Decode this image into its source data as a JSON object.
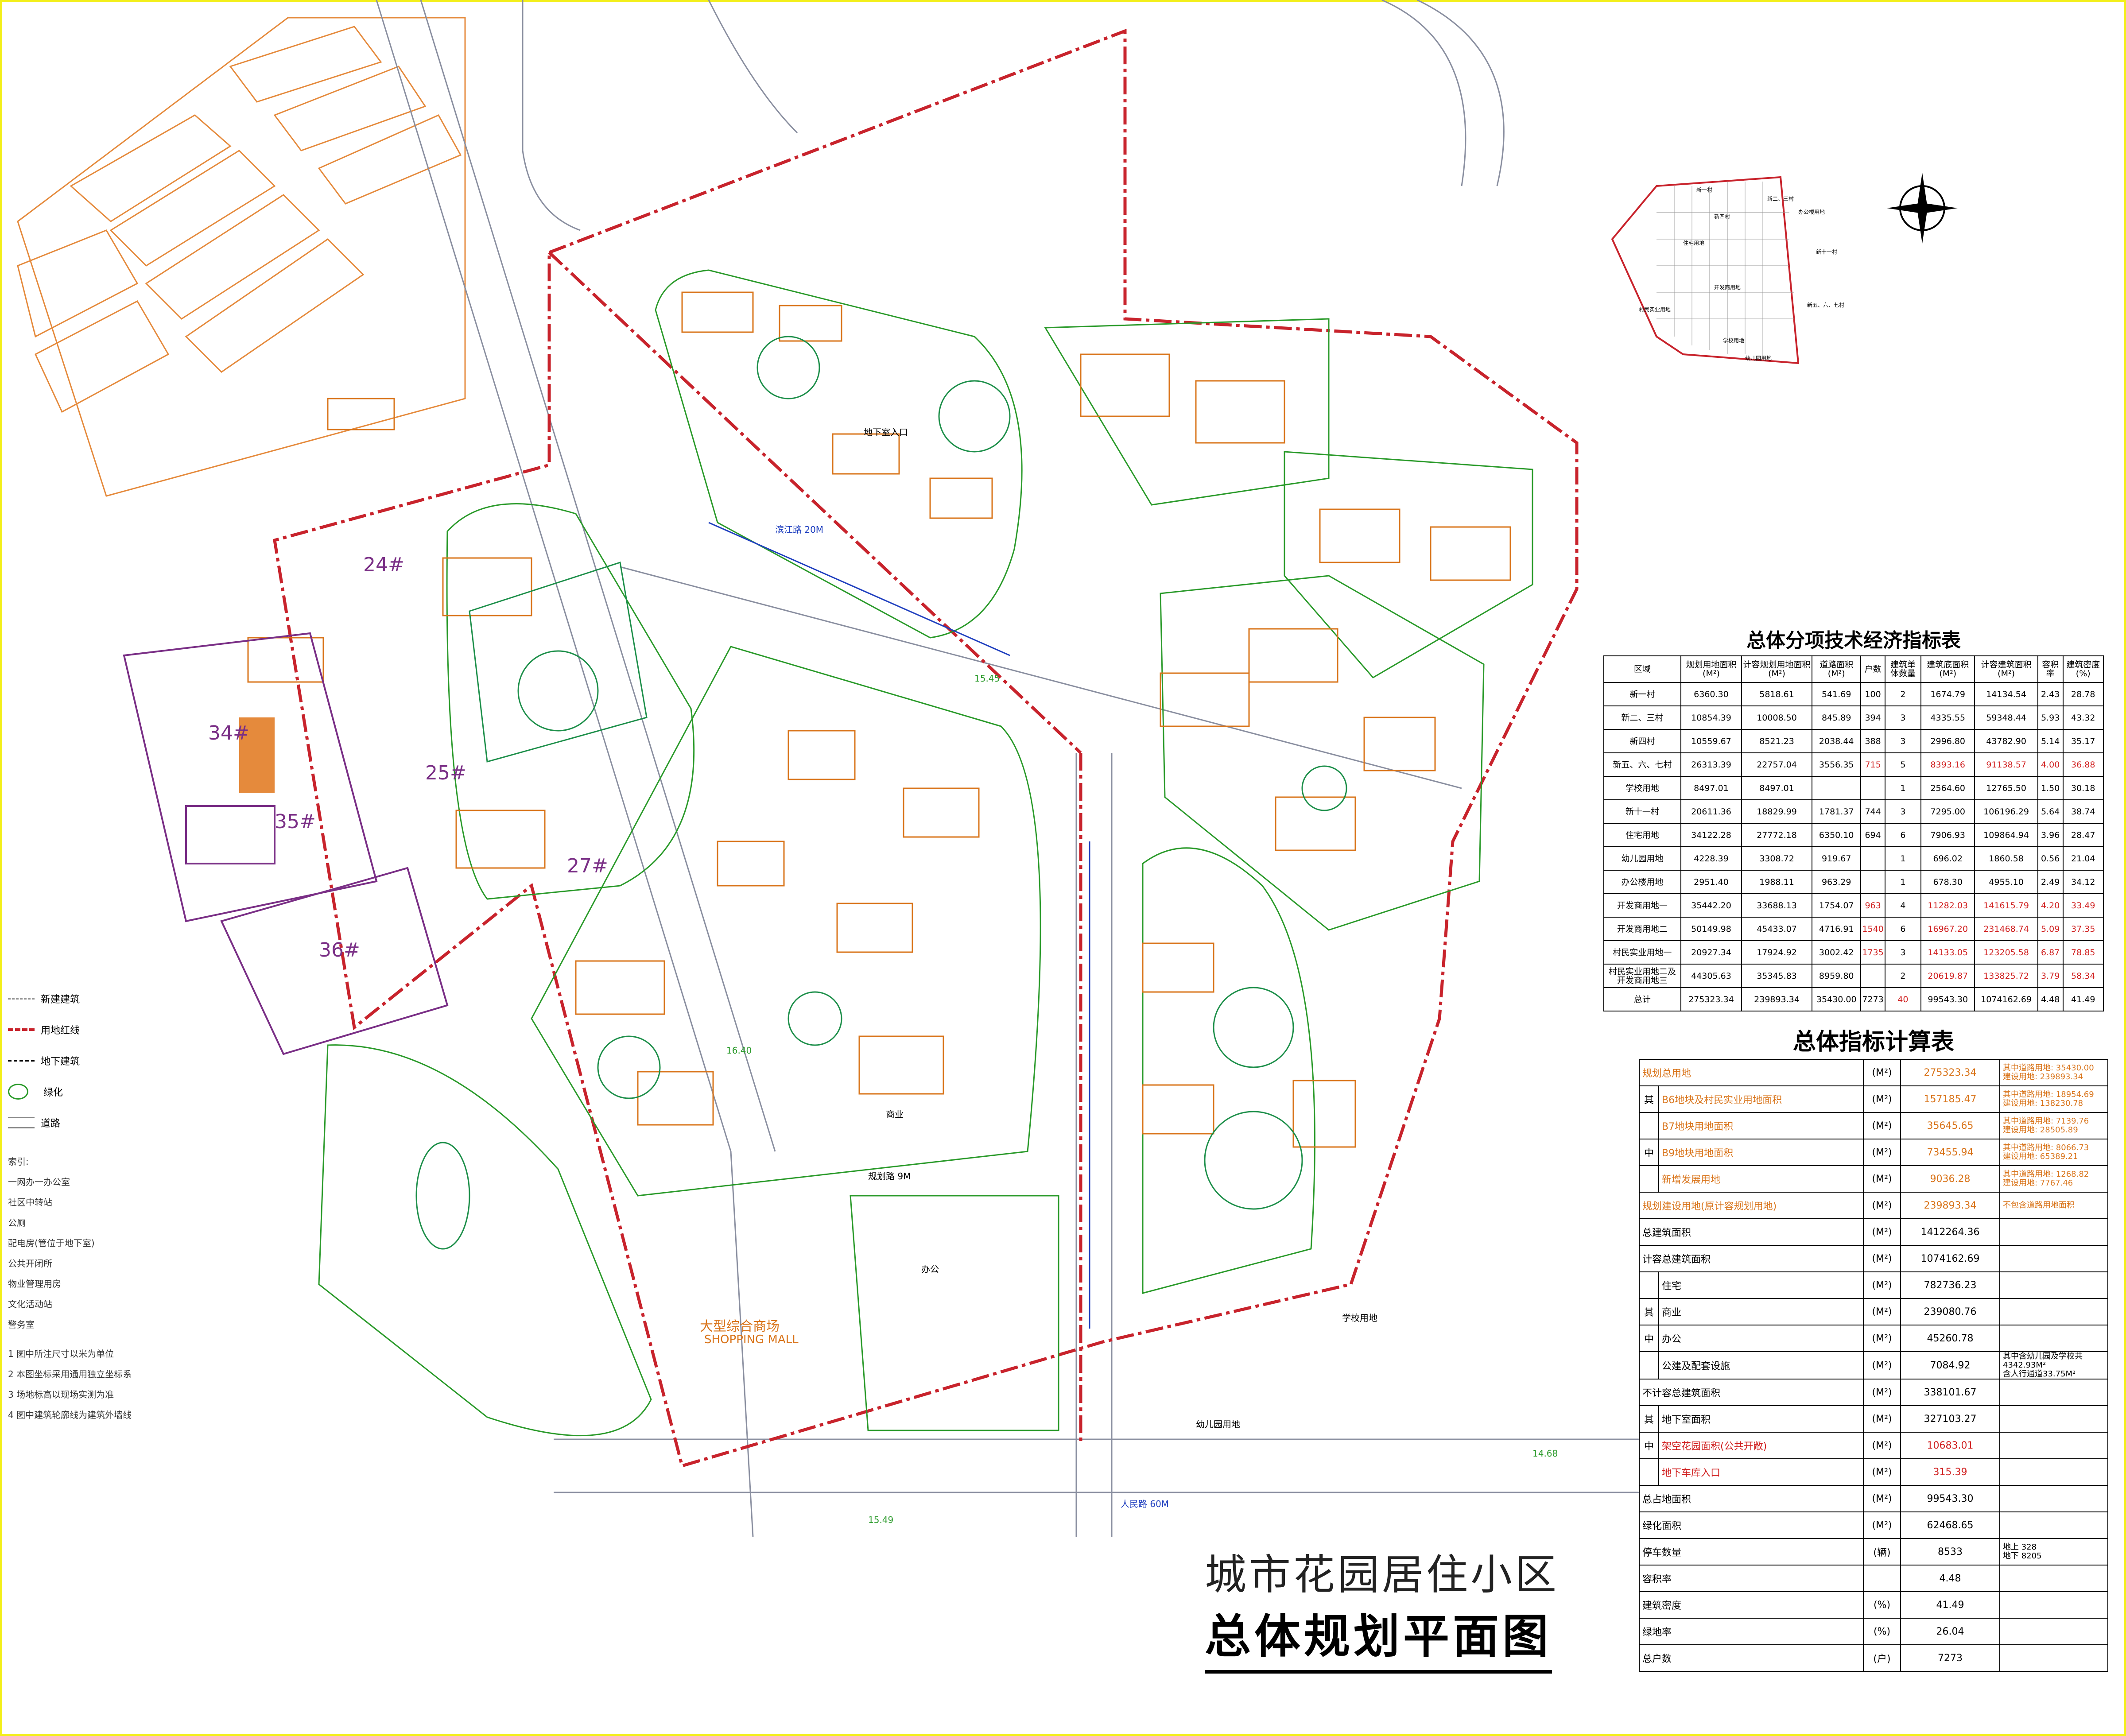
{
  "title": {
    "line1": "城市花园居住小区",
    "line2": "总体规划平面图"
  },
  "legend": [
    {
      "icon": "dashed-line-icon",
      "label": "新建建筑"
    },
    {
      "icon": "red-line-icon",
      "label": "用地红线"
    },
    {
      "icon": "dash-line-icon",
      "label": "地下建筑"
    },
    {
      "icon": "tree-icon",
      "label": "绿化"
    },
    {
      "icon": "road-icon",
      "label": "道路"
    }
  ],
  "index_title": "索引:",
  "index_items": [
    "一网办一办公室",
    "社区中转站",
    "公厕",
    "配电房(管位于地下室)",
    "公共开闭所",
    "物业管理用房",
    "文化活动站",
    "警务室"
  ],
  "notes": [
    "1 图中所注尺寸以米为单位",
    "2 本图坐标采用通用独立坐标系",
    "3 场地标高以现场实测为准",
    "4 图中建筑轮廓线为建筑外墙线"
  ],
  "labels": {
    "b24": "24#",
    "b25": "25#",
    "b27": "27#",
    "b34": "34#",
    "b35": "35#",
    "b36": "36#",
    "mall": "大型综合商场",
    "mall_en": "SHOPPING MALL",
    "road_renmin": "人民路 60M",
    "road_guihua": "规划路 9M",
    "road_binjiang": "滨江路 20M",
    "entry": "地下室入口",
    "school": "学校用地",
    "kindergarten": "幼儿园用地",
    "office": "办公",
    "shop": "商业",
    "elev1": "15.45",
    "elev2": "16.40",
    "elev3": "14.68",
    "elev4": "15.49"
  },
  "inset_map": {
    "labels": [
      "新一村",
      "新二、三村",
      "新四村",
      "新十一村",
      "新五、六、七村",
      "办公楼用地",
      "开发商用地",
      "住宅用地",
      "学校用地",
      "幼儿园用地",
      "村民实业用地"
    ]
  },
  "tech_table": {
    "title": "总体分项技术经济指标表",
    "headers": [
      "区域",
      "规划用地面积(M²)",
      "计容规划用地面积(M²)",
      "道路面积(M²)",
      "户数",
      "建筑单体数量",
      "建筑底面积(M²)",
      "计容建筑面积(M²)",
      "容积率",
      "建筑密度(%)"
    ],
    "rows": [
      [
        "新一村",
        "6360.30",
        "5818.61",
        "541.69",
        "100",
        "2",
        "1674.79",
        "14134.54",
        "2.43",
        "28.78"
      ],
      [
        "新二、三村",
        "10854.39",
        "10008.50",
        "845.89",
        "394",
        "3",
        "4335.55",
        "59348.44",
        "5.93",
        "43.32"
      ],
      [
        "新四村",
        "10559.67",
        "8521.23",
        "2038.44",
        "388",
        "3",
        "2996.80",
        "43782.90",
        "5.14",
        "35.17"
      ],
      [
        "新五、六、七村",
        "26313.39",
        "22757.04",
        "3556.35",
        "715",
        "5",
        "8393.16",
        "91138.57",
        "4.00",
        "36.88"
      ],
      [
        "学校用地",
        "8497.01",
        "8497.01",
        "",
        "",
        "1",
        "2564.60",
        "12765.50",
        "1.50",
        "30.18"
      ],
      [
        "新十一村",
        "20611.36",
        "18829.99",
        "1781.37",
        "744",
        "3",
        "7295.00",
        "106196.29",
        "5.64",
        "38.74"
      ],
      [
        "住宅用地",
        "34122.28",
        "27772.18",
        "6350.10",
        "694",
        "6",
        "7906.93",
        "109864.94",
        "3.96",
        "28.47"
      ],
      [
        "幼儿园用地",
        "4228.39",
        "3308.72",
        "919.67",
        "",
        "1",
        "696.02",
        "1860.58",
        "0.56",
        "21.04"
      ],
      [
        "办公楼用地",
        "2951.40",
        "1988.11",
        "963.29",
        "",
        "1",
        "678.30",
        "4955.10",
        "2.49",
        "34.12"
      ],
      [
        "开发商用地一",
        "35442.20",
        "33688.13",
        "1754.07",
        "963",
        "4",
        "11282.03",
        "141615.79",
        "4.20",
        "33.49"
      ],
      [
        "开发商用地二",
        "50149.98",
        "45433.07",
        "4716.91",
        "1540",
        "6",
        "16967.20",
        "231468.74",
        "5.09",
        "37.35"
      ],
      [
        "村民实业用地一",
        "20927.34",
        "17924.92",
        "3002.42",
        "1735",
        "3",
        "14133.05",
        "123205.58",
        "6.87",
        "78.85"
      ],
      [
        "村民实业用地二及开发商用地三",
        "44305.63",
        "35345.83",
        "8959.80",
        "",
        "2",
        "20619.87",
        "133825.72",
        "3.79",
        "58.34"
      ],
      [
        "总计",
        "275323.34",
        "239893.34",
        "35430.00",
        "7273",
        "40",
        "99543.30",
        "1074162.69",
        "4.48",
        "41.49"
      ]
    ]
  },
  "summary": {
    "title": "总体指标计算表",
    "rows": [
      {
        "g": "",
        "label": "规划总用地",
        "unit": "(M²)",
        "value": "275323.34",
        "note": "其中道路用地: 35430.00\n建设用地: 239893.34",
        "color": "or"
      },
      {
        "g": "其",
        "label": "B6地块及村民实业用地面积",
        "unit": "(M²)",
        "value": "157185.47",
        "note": "其中道路用地: 18954.69\n建设用地: 138230.78",
        "color": "or"
      },
      {
        "g": "",
        "label": "B7地块用地面积",
        "unit": "(M²)",
        "value": "35645.65",
        "note": "其中道路用地: 7139.76\n建设用地: 28505.89",
        "color": "or"
      },
      {
        "g": "中",
        "label": "B9地块用地面积",
        "unit": "(M²)",
        "value": "73455.94",
        "note": "其中道路用地: 8066.73\n建设用地: 65389.21",
        "color": "or"
      },
      {
        "g": "",
        "label": "新增发展用地",
        "unit": "(M²)",
        "value": "9036.28",
        "note": "其中道路用地: 1268.82\n建设用地: 7767.46",
        "color": "or"
      },
      {
        "g": "",
        "label": "规划建设用地(原计容规划用地)",
        "unit": "(M²)",
        "value": "239893.34",
        "note": "不包含道路用地面积",
        "color": "or"
      },
      {
        "g": "",
        "label": "总建筑面积",
        "unit": "(M²)",
        "value": "1412264.36",
        "note": "",
        "color": ""
      },
      {
        "g": "",
        "label": "计容总建筑面积",
        "unit": "(M²)",
        "value": "1074162.69",
        "note": "",
        "color": ""
      },
      {
        "g": "",
        "label": "住宅",
        "unit": "(M²)",
        "value": "782736.23",
        "note": "",
        "color": ""
      },
      {
        "g": "其",
        "label": "商业",
        "unit": "(M²)",
        "value": "239080.76",
        "note": "",
        "color": ""
      },
      {
        "g": "中",
        "label": "办公",
        "unit": "(M²)",
        "value": "45260.78",
        "note": "",
        "color": ""
      },
      {
        "g": "",
        "label": "公建及配套设施",
        "unit": "(M²)",
        "value": "7084.92",
        "note": "其中含幼儿园及学校共4342.93M²\n含人行通道33.75M²",
        "color": ""
      },
      {
        "g": "",
        "label": "不计容总建筑面积",
        "unit": "(M²)",
        "value": "338101.67",
        "note": "",
        "color": ""
      },
      {
        "g": "其",
        "label": "地下室面积",
        "unit": "(M²)",
        "value": "327103.27",
        "note": "",
        "color": ""
      },
      {
        "g": "中",
        "label": "架空花园面积(公共开敞)",
        "unit": "(M²)",
        "value": "10683.01",
        "note": "",
        "color": "red"
      },
      {
        "g": "",
        "label": "地下车库入口",
        "unit": "(M²)",
        "value": "315.39",
        "note": "",
        "color": "red"
      },
      {
        "g": "",
        "label": "总占地面积",
        "unit": "(M²)",
        "value": "99543.30",
        "note": "",
        "color": ""
      },
      {
        "g": "",
        "label": "绿化面积",
        "unit": "(M²)",
        "value": "62468.65",
        "note": "",
        "color": ""
      },
      {
        "g": "",
        "label": "停车数量",
        "unit": "(辆)",
        "value": "8533",
        "note": "地上      328\n地下      8205",
        "color": ""
      },
      {
        "g": "",
        "label": "容积率",
        "unit": "",
        "value": "4.48",
        "note": "",
        "color": ""
      },
      {
        "g": "",
        "label": "建筑密度",
        "unit": "(%)",
        "value": "41.49",
        "note": "",
        "color": ""
      },
      {
        "g": "",
        "label": "绿地率",
        "unit": "(%)",
        "value": "26.04",
        "note": "",
        "color": ""
      },
      {
        "g": "",
        "label": "总户数",
        "unit": "(户)",
        "value": "7273",
        "note": "",
        "color": ""
      }
    ]
  },
  "colors": {
    "redline": "#c8232c",
    "building": "#d9741a",
    "road": "#5a6fa8",
    "green": "#2a9a2a",
    "purple": "#7a2f86",
    "blue": "#1f3fbf"
  }
}
